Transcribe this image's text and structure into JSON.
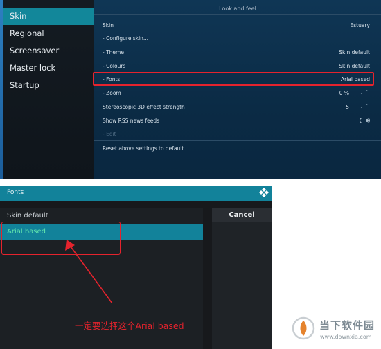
{
  "sidebar": {
    "items": [
      {
        "label": "Skin",
        "active": true
      },
      {
        "label": "Regional",
        "active": false
      },
      {
        "label": "Screensaver",
        "active": false
      },
      {
        "label": "Master lock",
        "active": false
      },
      {
        "label": "Startup",
        "active": false
      }
    ]
  },
  "panel": {
    "title": "Look and feel",
    "rows": [
      {
        "label": "Skin",
        "value": "Estuary"
      },
      {
        "label": "- Configure skin...",
        "value": ""
      },
      {
        "label": "- Theme",
        "value": "Skin default"
      },
      {
        "label": "- Colours",
        "value": "Skin default"
      },
      {
        "label": "- Fonts",
        "value": "Arial based"
      },
      {
        "label": "- Zoom",
        "value": "0 %"
      },
      {
        "label": "Stereoscopic 3D effect strength",
        "value": "5"
      },
      {
        "label": "Show RSS news feeds",
        "value": ""
      },
      {
        "label": "- Edit",
        "value": ""
      }
    ],
    "reset_label": "Reset above settings to default"
  },
  "dialog": {
    "title": "Fonts",
    "options": [
      {
        "label": "Skin default",
        "selected": false
      },
      {
        "label": "Arial based",
        "selected": true
      }
    ],
    "cancel_label": "Cancel"
  },
  "annotation": {
    "text": "一定要选择这个Arial based"
  },
  "watermark": {
    "name": "当下软件园",
    "url": "www.downxia.com"
  },
  "colors": {
    "accent": "#12829a",
    "highlight_border": "#e5232d",
    "selected_text": "#62e6ad",
    "panel_bg": "#0c2a44"
  },
  "icons": {
    "toggle": "toggle-switch-icon",
    "spinner": "up-down-chevron-icon",
    "logo": "kodi-logo-icon"
  }
}
